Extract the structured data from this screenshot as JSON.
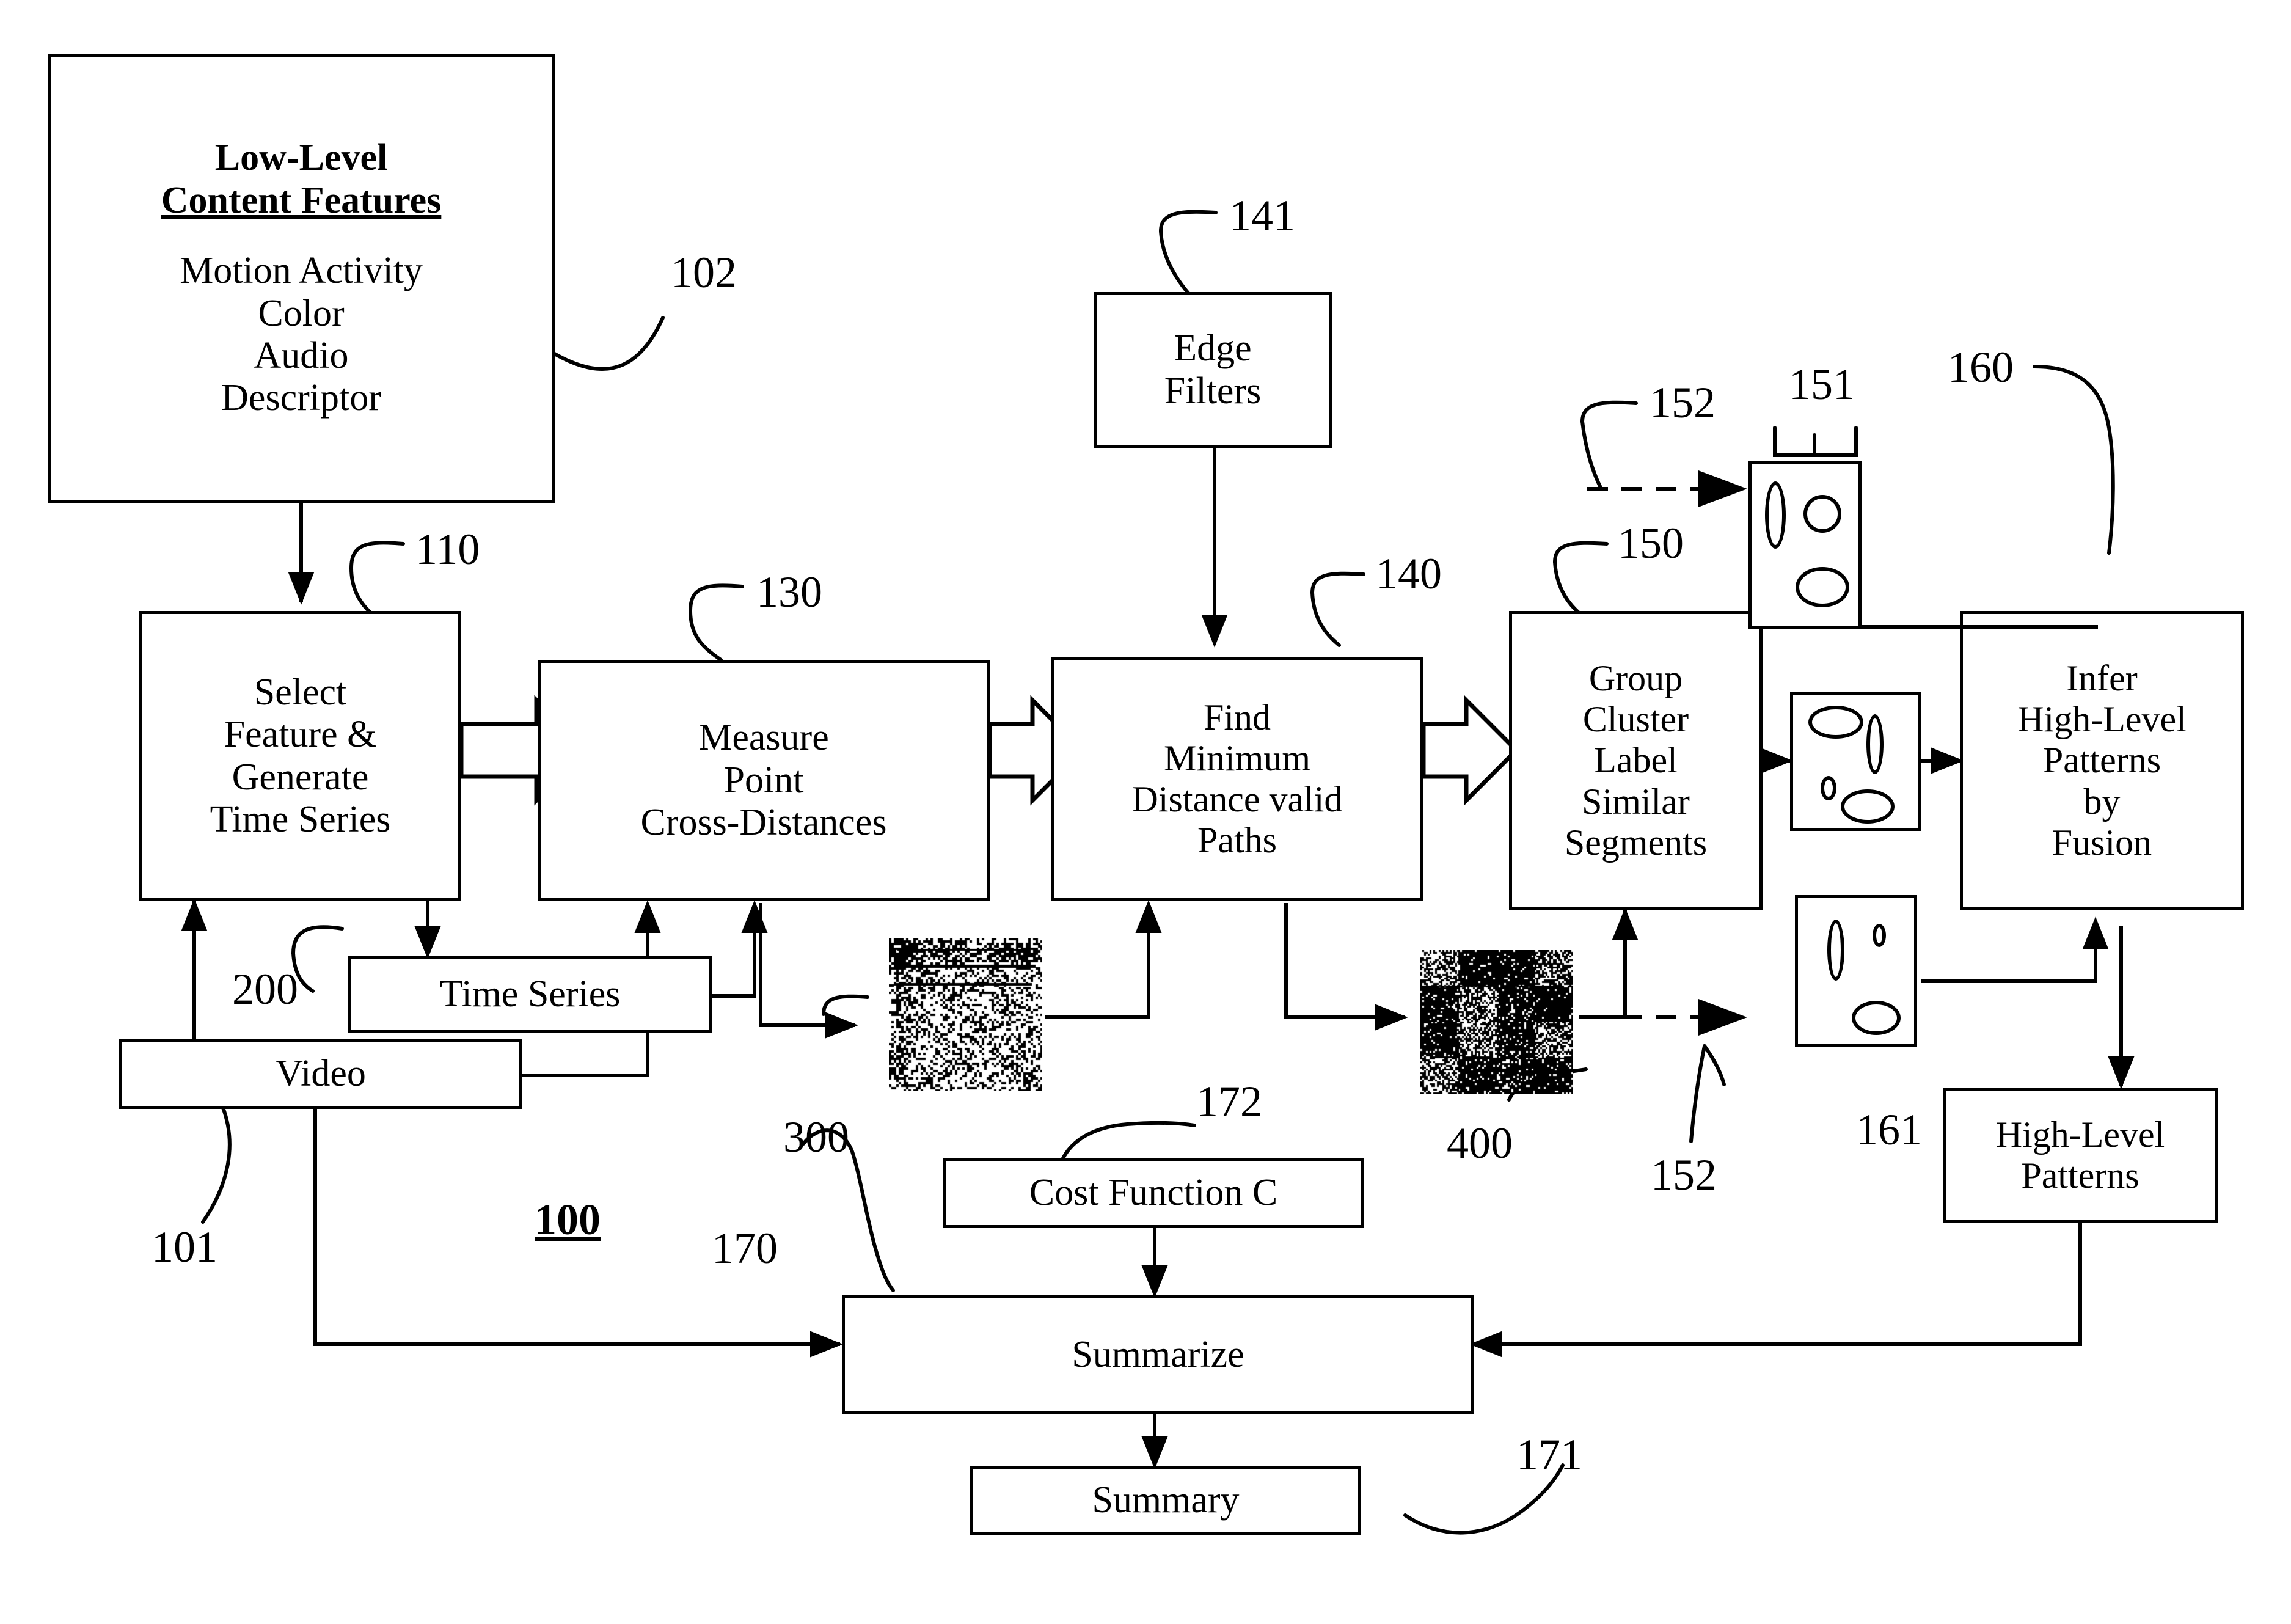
{
  "figure": {
    "system_ref": "100"
  },
  "boxes": {
    "low_level_features": {
      "title_line1": "Low-Level",
      "title_line2": "Content Features",
      "items": [
        "Motion Activity",
        "Color",
        "Audio",
        "Descriptor"
      ],
      "ref": "102"
    },
    "select_feature": {
      "lines": [
        "Select",
        "Feature &",
        "Generate",
        "Time Series"
      ],
      "ref": "110"
    },
    "measure_point": {
      "lines": [
        "Measure",
        "Point",
        "Cross-Distances"
      ],
      "ref": "130"
    },
    "find_minimum": {
      "lines": [
        "Find",
        "Minimum",
        "Distance valid",
        "Paths"
      ],
      "ref": "140"
    },
    "group_cluster": {
      "lines": [
        "Group",
        "Cluster",
        "Label",
        "Similar",
        "Segments"
      ],
      "ref": "150"
    },
    "infer_patterns": {
      "lines": [
        "Infer",
        "High-Level",
        "Patterns",
        "by",
        "Fusion"
      ],
      "ref": "160"
    },
    "edge_filters": {
      "lines": [
        "Edge",
        "Filters"
      ],
      "ref": "141"
    },
    "time_series": {
      "label": "Time Series",
      "ref": "200"
    },
    "video": {
      "label": "Video",
      "ref": "101"
    },
    "cost_function": {
      "label": "Cost Function C",
      "ref": "172"
    },
    "summarize": {
      "label": "Summarize",
      "ref": "170"
    },
    "summary": {
      "label": "Summary",
      "ref": "171"
    },
    "high_level_patterns": {
      "lines": [
        "High-Level",
        "Patterns"
      ],
      "ref": "161"
    }
  },
  "artifacts": {
    "cross_distance_matrix": {
      "ref": "300"
    },
    "cluster_label_matrix": {
      "ref": "400"
    },
    "segment_image_top": {
      "ref": "151"
    },
    "segment_image_middle": {
      "ref": ""
    },
    "segment_image_bottom": {
      "ref": ""
    },
    "dashed_input_top": {
      "ref": "152"
    },
    "dashed_input_bottom": {
      "ref": "152"
    }
  },
  "refs": {
    "r100": "100",
    "r101": "101",
    "r102": "102",
    "r110": "110",
    "r130": "130",
    "r140": "140",
    "r141": "141",
    "r150": "150",
    "r151": "151",
    "r152a": "152",
    "r152b": "152",
    "r160": "160",
    "r161": "161",
    "r170": "170",
    "r171": "171",
    "r172": "172",
    "r200": "200",
    "r300": "300",
    "r400": "400"
  },
  "colors": {
    "ink": "#000000",
    "paper": "#ffffff"
  }
}
